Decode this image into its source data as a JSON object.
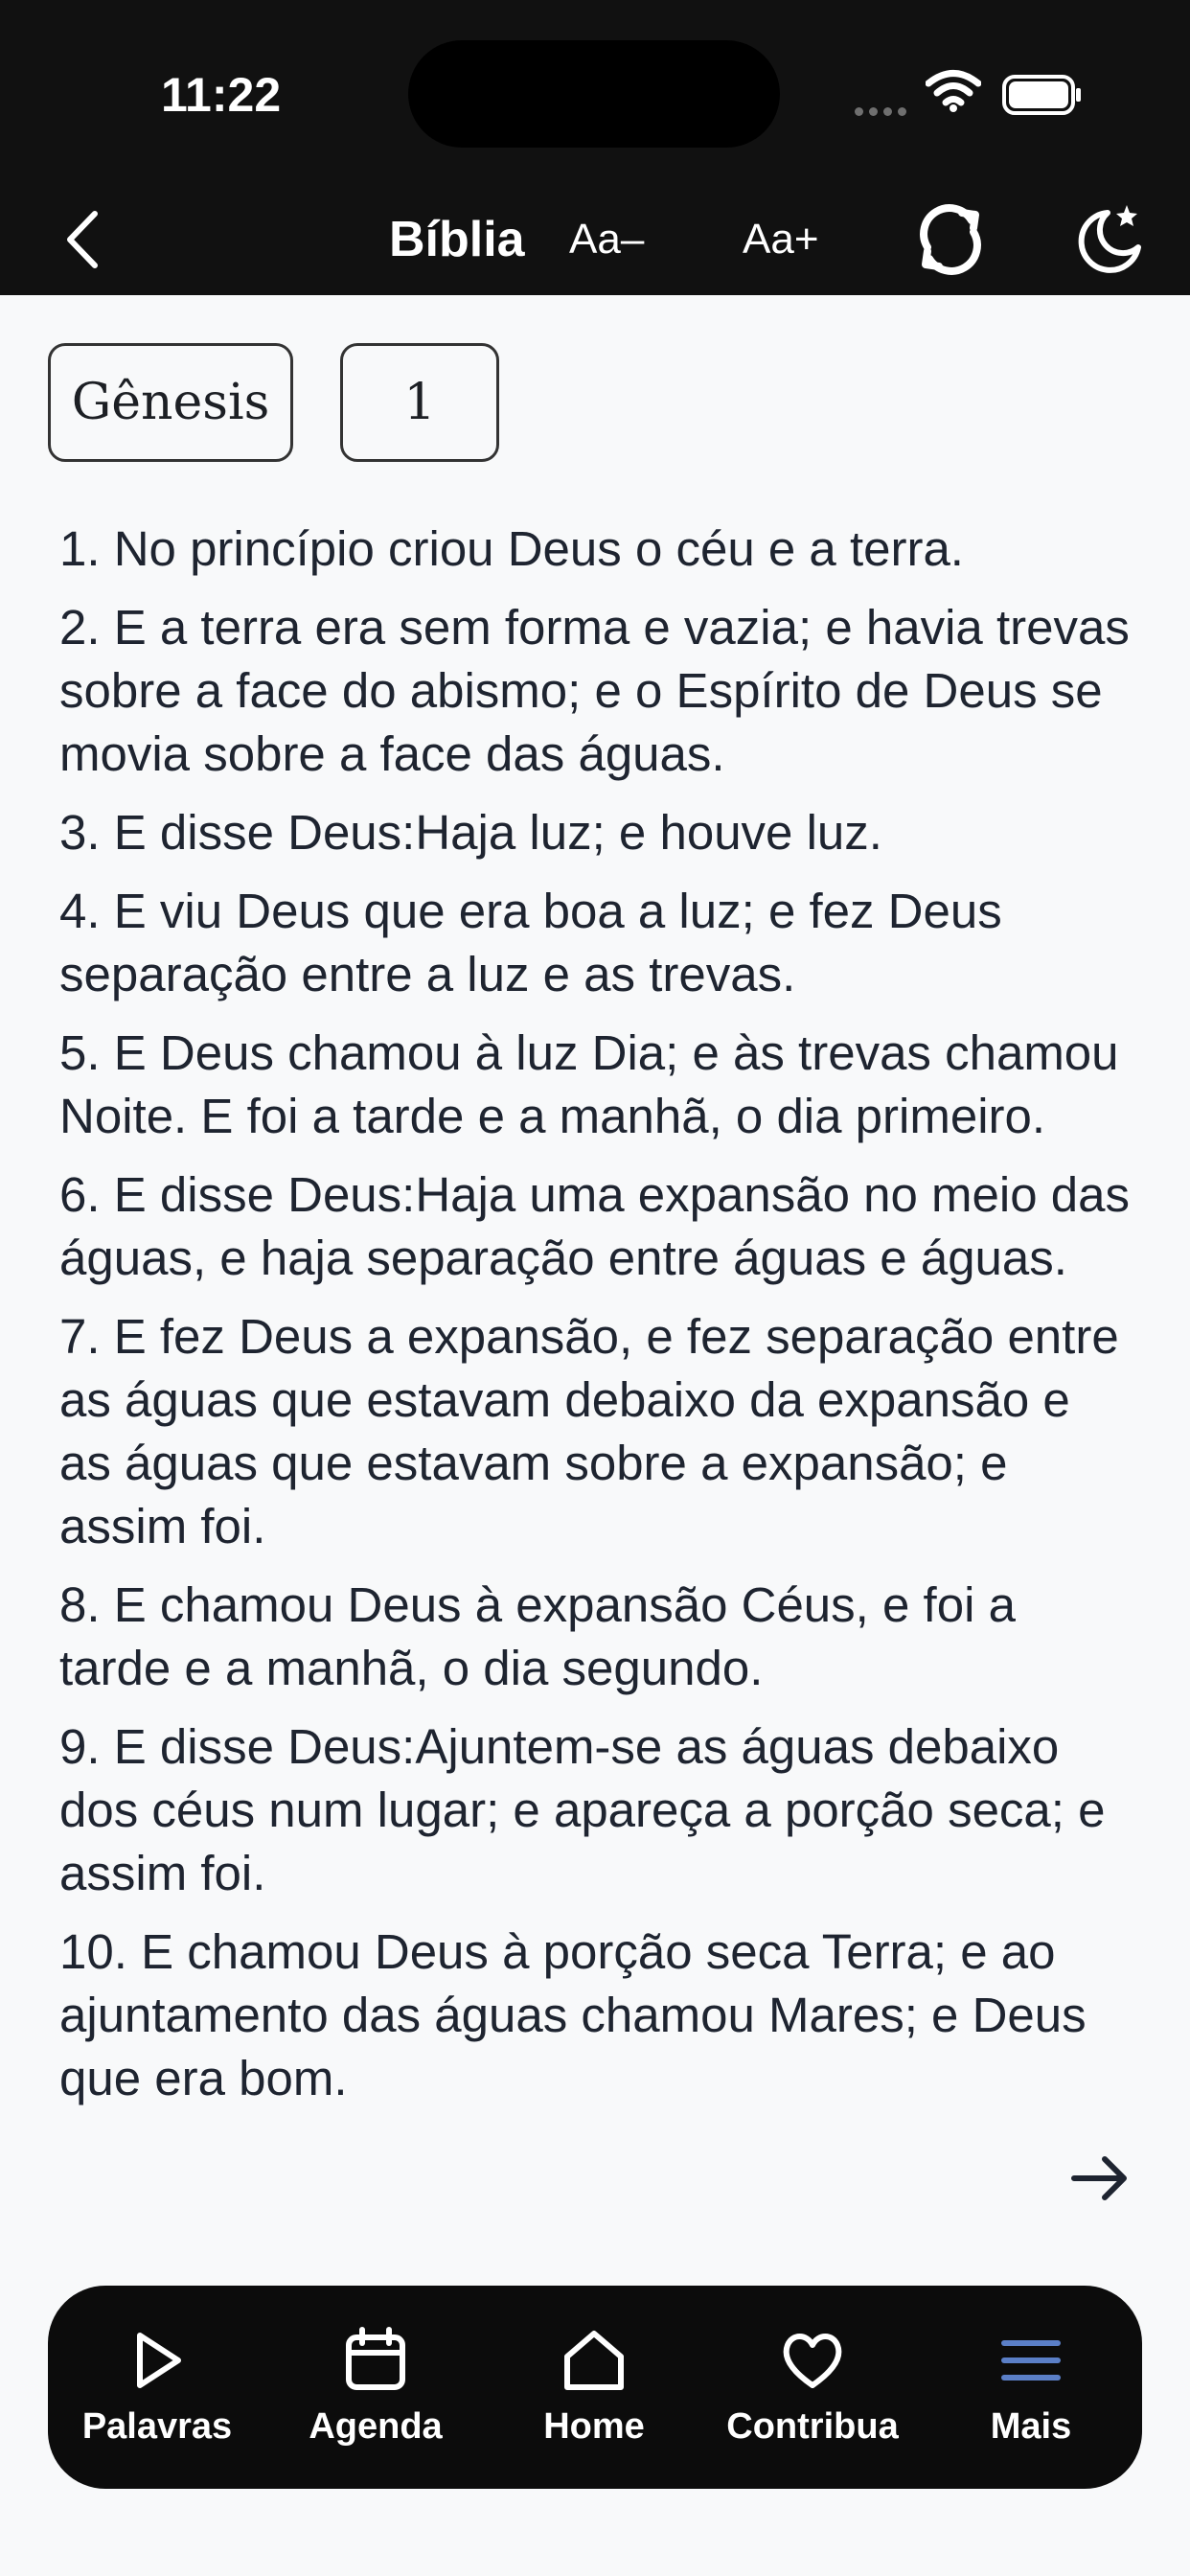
{
  "status_bar": {
    "time": "11:22"
  },
  "header": {
    "title": "Bíblia",
    "font_decrease": "Aa–",
    "font_increase": "Aa+"
  },
  "selectors": {
    "book": "Gênesis",
    "chapter": "1"
  },
  "verses": [
    "1. No princípio criou Deus o céu e a terra.",
    "2. E a terra era sem forma e vazia; e havia trevas sobre a face do abismo; e o Espírito de Deus se movia sobre a face das águas.",
    "3. E disse Deus:Haja luz; e houve luz.",
    "4. E viu Deus que era boa a luz; e fez Deus separação entre a luz e as trevas.",
    "5. E Deus chamou à luz Dia; e às trevas chamou Noite. E foi a tarde e a manhã, o dia primeiro.",
    "6. E disse Deus:Haja uma expansão no meio das águas, e haja separação entre águas e águas.",
    "7. E fez Deus a expansão, e fez separação entre as águas que estavam debaixo da expansão e as águas que estavam sobre a expansão; e assim foi.",
    "8. E chamou Deus à expansão Céus, e foi a tarde e a manhã, o dia segundo.",
    "9. E disse Deus:Ajuntem-se as águas debaixo dos céus num lugar; e apareça a porção seca; e assim foi.",
    "10. E chamou Deus à porção seca Terra; e ao ajuntamento das águas chamou Mares; e Deus que era bom."
  ],
  "bottom_nav": {
    "items": [
      {
        "label": "Palavras",
        "icon": "play-icon"
      },
      {
        "label": "Agenda",
        "icon": "calendar-icon"
      },
      {
        "label": "Home",
        "icon": "home-icon"
      },
      {
        "label": "Contribua",
        "icon": "heart-icon"
      },
      {
        "label": "Mais",
        "icon": "menu-icon"
      }
    ],
    "active_index": 4
  },
  "colors": {
    "header_bg": "#111111",
    "page_bg": "#f8f9fa",
    "text": "#1e2430",
    "nav_bg": "#0c0c0c",
    "active_icon": "#5b7fc7"
  }
}
